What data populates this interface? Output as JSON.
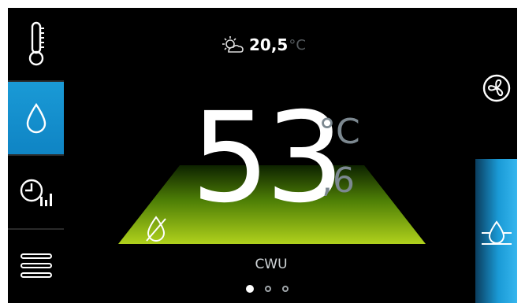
{
  "colors": {
    "background": "#000000",
    "accent": "#1a9ad6",
    "gauge_green": "#b0d11c",
    "muted": "#7c8890"
  },
  "sidebar": {
    "items": [
      {
        "icon": "thermometer-icon",
        "active": false
      },
      {
        "icon": "water-drop-icon",
        "active": true
      },
      {
        "icon": "clock-schedule-icon",
        "active": false
      },
      {
        "icon": "menu-icon",
        "active": false
      }
    ]
  },
  "weather": {
    "icon": "sun-cloud-icon",
    "outdoor_temp": "20,5",
    "unit": "°C"
  },
  "main": {
    "temp_int": "53",
    "unit": "°C",
    "temp_dec": ",6",
    "mode_label": "CWU",
    "status_icon": "no-water-icon"
  },
  "right": {
    "fan_icon": "fan-icon",
    "heater_icon": "water-heater-icon"
  },
  "pagination": {
    "pages": 3,
    "current": 1
  }
}
